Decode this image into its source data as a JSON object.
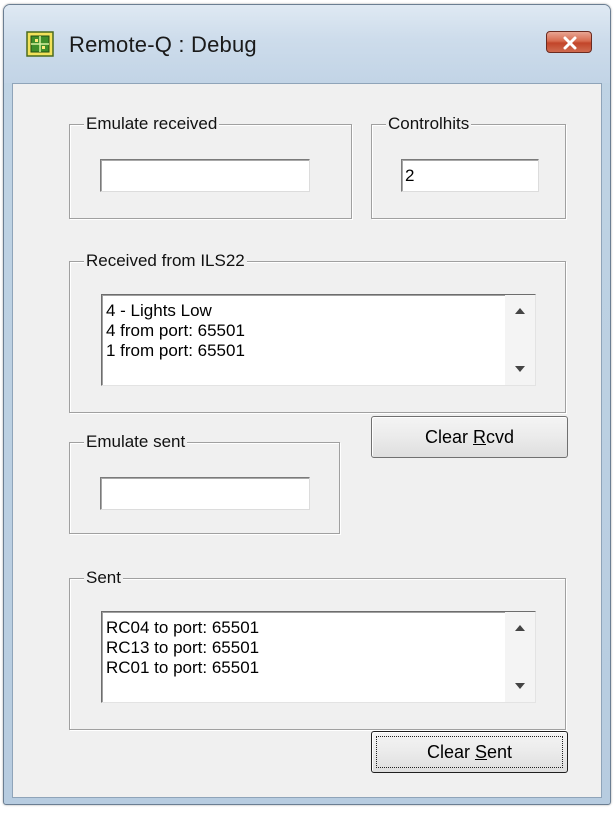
{
  "window": {
    "title": "Remote-Q : Debug"
  },
  "icons": {
    "app": "app-icon",
    "close": "close-icon",
    "scroll_up": "scroll-up-arrow-icon",
    "scroll_down": "scroll-down-arrow-icon"
  },
  "colors": {
    "close_button": "#d05a3f",
    "dialog_face": "#f0f0f0",
    "title_bar": "#c9dceb"
  },
  "emulate_received": {
    "label": "Emulate received",
    "value": ""
  },
  "controlhits": {
    "label": "Controlhits",
    "value": "2"
  },
  "received": {
    "label": "Received from ILS22",
    "items": [
      "4 - Lights Low",
      "4 from port: 65501",
      "1 from port: 65501"
    ]
  },
  "clear_rcvd": {
    "label_pre": "Clear ",
    "label_accel": "R",
    "label_post": "cvd"
  },
  "emulate_sent": {
    "label": "Emulate sent",
    "value": ""
  },
  "sent": {
    "label": "Sent",
    "items": [
      "RC04 to port: 65501",
      "RC13 to port: 65501",
      "RC01 to port: 65501"
    ]
  },
  "clear_sent": {
    "label_pre": "Clear ",
    "label_accel": "S",
    "label_post": "ent"
  }
}
